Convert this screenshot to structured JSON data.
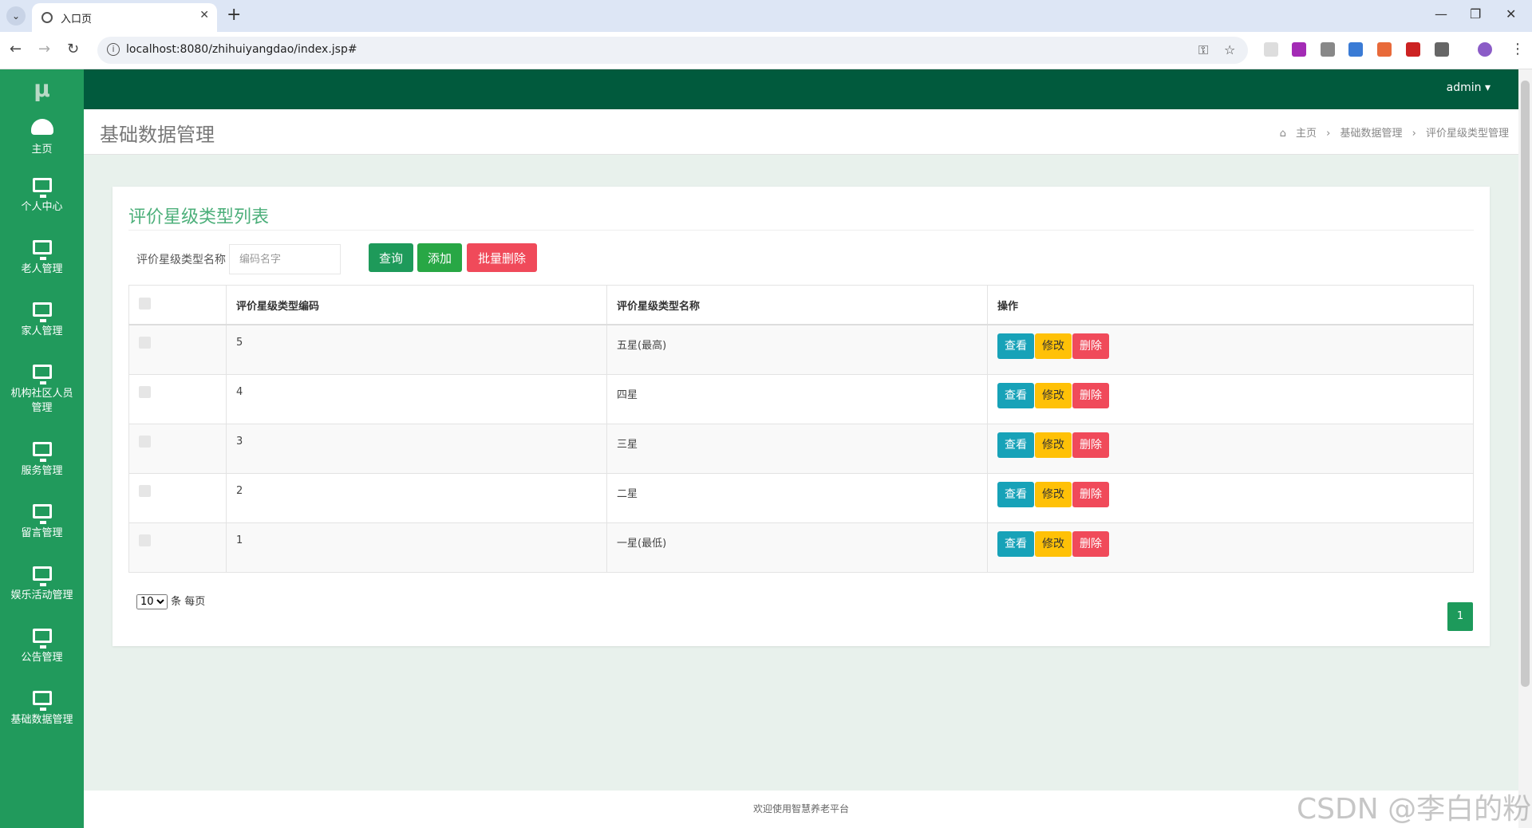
{
  "browser": {
    "tab_title": "入口页",
    "url": "localhost:8080/zhihuiyangdao/index.jsp#"
  },
  "app": {
    "logo": "μ",
    "user_menu": "admin ▾"
  },
  "sidebar": {
    "items": [
      {
        "label": "主页",
        "icon": "dashboard-icon"
      },
      {
        "label": "个人中心",
        "icon": "monitor-icon"
      },
      {
        "label": "老人管理",
        "icon": "monitor-icon"
      },
      {
        "label": "家人管理",
        "icon": "monitor-icon"
      },
      {
        "label": "机构社区人员管理",
        "icon": "monitor-icon"
      },
      {
        "label": "服务管理",
        "icon": "monitor-icon"
      },
      {
        "label": "留言管理",
        "icon": "monitor-icon"
      },
      {
        "label": "娱乐活动管理",
        "icon": "monitor-icon"
      },
      {
        "label": "公告管理",
        "icon": "monitor-icon"
      },
      {
        "label": "基础数据管理",
        "icon": "monitor-icon"
      }
    ]
  },
  "header": {
    "title": "基础数据管理",
    "breadcrumb": [
      "主页",
      "基础数据管理",
      "评价星级类型管理"
    ]
  },
  "panel": {
    "title": "评价星级类型列表",
    "search_label": "评价星级类型名称",
    "search_placeholder": "编码名字",
    "buttons": {
      "query": "查询",
      "add": "添加",
      "batch_delete": "批量删除"
    },
    "columns": [
      "评价星级类型编码",
      "评价星级类型名称",
      "操作"
    ],
    "rows": [
      {
        "code": "5",
        "name": "五星(最高)"
      },
      {
        "code": "4",
        "name": "四星"
      },
      {
        "code": "3",
        "name": "三星"
      },
      {
        "code": "2",
        "name": "二星"
      },
      {
        "code": "1",
        "name": "一星(最低)"
      }
    ],
    "row_actions": {
      "view": "查看",
      "edit": "修改",
      "delete": "删除"
    },
    "page_size": "10",
    "page_size_suffix": "条 每页",
    "current_page": "1"
  },
  "footer": {
    "text": "欢迎使用智慧养老平台"
  },
  "watermark": "CSDN @李白的粉",
  "colors": {
    "sidebar": "#219a5c",
    "topbar": "#015a3d",
    "view": "#17a2b8",
    "edit": "#ffc107",
    "delete": "#f04a5a",
    "add": "#28a745",
    "query": "#1e9a5a"
  }
}
